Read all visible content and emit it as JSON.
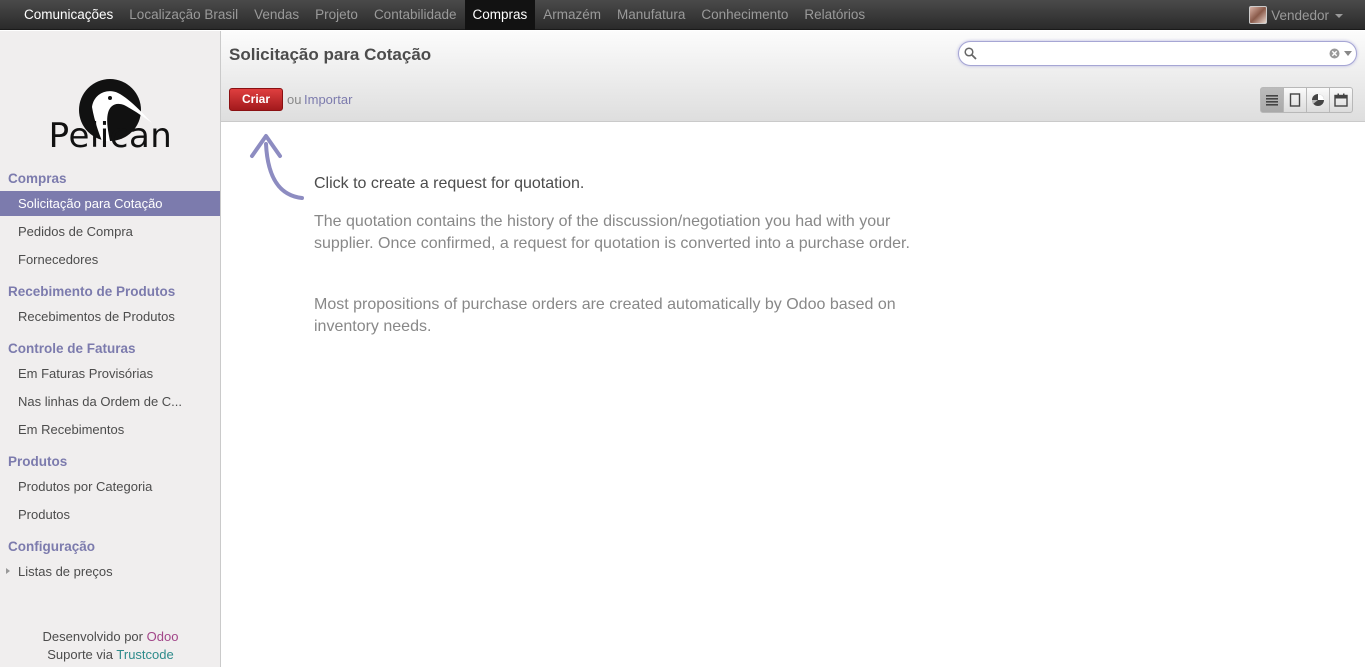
{
  "topmenu": [
    {
      "label": "Comunicações",
      "state": "white"
    },
    {
      "label": "Localização Brasil",
      "state": ""
    },
    {
      "label": "Vendas",
      "state": ""
    },
    {
      "label": "Projeto",
      "state": ""
    },
    {
      "label": "Contabilidade",
      "state": ""
    },
    {
      "label": "Compras",
      "state": "active"
    },
    {
      "label": "Armazém",
      "state": ""
    },
    {
      "label": "Manufatura",
      "state": ""
    },
    {
      "label": "Conhecimento",
      "state": ""
    },
    {
      "label": "Relatórios",
      "state": ""
    }
  ],
  "user": {
    "name": "Vendedor"
  },
  "logo": {
    "text": "Pelican"
  },
  "sidebar": {
    "sections": [
      {
        "title": "Compras",
        "items": [
          "Solicitação para Cotação",
          "Pedidos de Compra",
          "Fornecedores"
        ]
      },
      {
        "title": "Recebimento de Produtos",
        "items": [
          "Recebimentos de Produtos"
        ]
      },
      {
        "title": "Controle de Faturas",
        "items": [
          "Em Faturas Provisórias",
          "Nas linhas da Ordem de C...",
          "Em Recebimentos"
        ]
      },
      {
        "title": "Produtos",
        "items": [
          "Produtos por Categoria",
          "Produtos"
        ]
      },
      {
        "title": "Configuração",
        "items": [
          "Listas de preços"
        ]
      }
    ],
    "active_item": "Solicitação para Cotação",
    "footer": {
      "developed_by": "Desenvolvido por",
      "developer": "Odoo",
      "support_via": "Suporte via",
      "support": "Trustcode"
    }
  },
  "main": {
    "title": "Solicitação para Cotação",
    "search": {
      "value": "",
      "placeholder": ""
    },
    "create_label": "Criar",
    "or_label": "ou",
    "import_label": "Importar",
    "view_icons": [
      "list-view-icon",
      "form-view-icon",
      "graph-view-icon",
      "calendar-view-icon"
    ],
    "active_view": "list-view-icon",
    "help": [
      "Click to create a request for quotation.",
      "The quotation contains the history of the discussion/negotiation you had with your supplier. Once confirmed, a request for quotation is converted into a purchase order.",
      "Most propositions of purchase orders are created automatically by Odoo based on inventory needs."
    ]
  },
  "colors": {
    "topbar": "#414141",
    "accent": "#7c7bad",
    "create_button": "#c42a2c",
    "sidebar_bg": "#f0eeee"
  }
}
